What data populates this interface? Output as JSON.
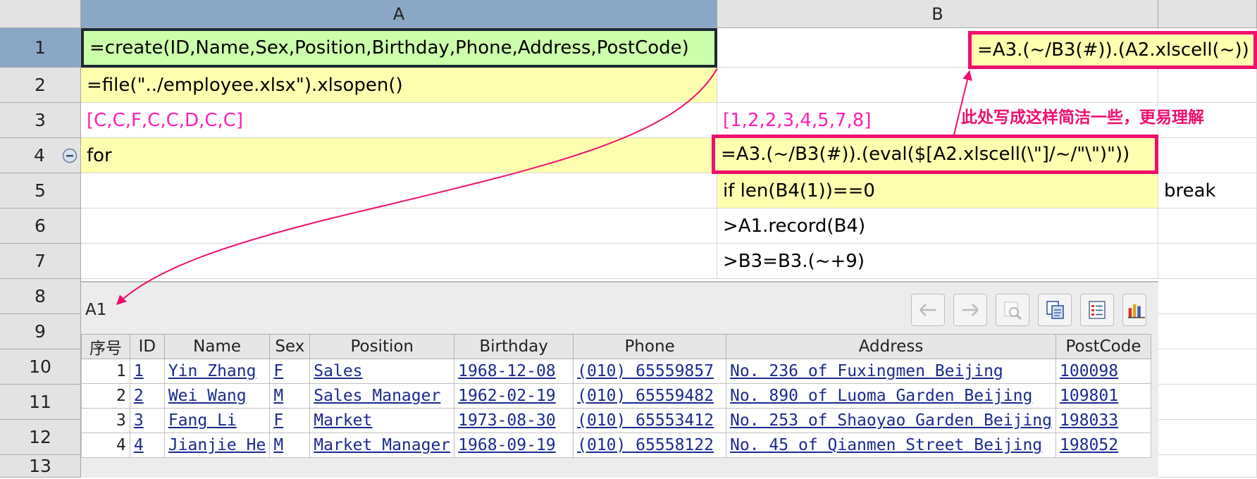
{
  "columns": {
    "corner": "",
    "a": "A",
    "b": "B",
    "c": ""
  },
  "rows": [
    "1",
    "2",
    "3",
    "4",
    "5",
    "6",
    "7",
    "8",
    "9",
    "10",
    "11",
    "12",
    "13"
  ],
  "cells": {
    "a1": "=create(ID,Name,Sex,Position,Birthday,Phone,Address,PostCode)",
    "a2": "=file(\"../employee.xlsx\").xlsopen()",
    "a3": "[C,C,F,C,C,D,C,C]",
    "a4": "for",
    "b3": "[1,2,2,3,4,5,7,8]",
    "b4": "=A3.(~/B3(#)).(eval($[A2.xlscell(\\\"]/~/\"\\\")\"))",
    "b5": "if len(B4(1))==0",
    "c5": "break",
    "b6": ">A1.record(B4)",
    "b7": ">B3=B3.(~+9)",
    "b1_callout": "=A3.(~/B3(#)).(A2.xlscell(~))"
  },
  "annotation": "此处写成这样简洁一些，更易理解",
  "collapse_icon": "minus-circle-icon",
  "result_panel": {
    "cell_ref": "A1",
    "toolbar": [
      "arrow-left-icon",
      "arrow-right-icon",
      "zoom-icon",
      "copy-icon",
      "list-icon",
      "chart-icon"
    ],
    "headers": [
      "序号",
      "ID",
      "Name",
      "Sex",
      "Position",
      "Birthday",
      "Phone",
      "Address",
      "PostCode"
    ],
    "rows": [
      [
        "1",
        "1",
        "Yin Zhang",
        "F",
        "Sales",
        "1968-12-08",
        "(010) 65559857",
        "No. 236 of Fuxingmen Beijing",
        "100098"
      ],
      [
        "2",
        "2",
        "Wei Wang",
        "M",
        "Sales Manager",
        "1962-02-19",
        "(010) 65559482",
        "No. 890 of Luoma Garden Beijing",
        "109801"
      ],
      [
        "3",
        "3",
        "Fang Li",
        "F",
        "Market",
        "1973-08-30",
        "(010) 65553412",
        "No. 253 of Shaoyao Garden Beijing",
        "198033"
      ],
      [
        "4",
        "4",
        "Jianjie He",
        "M",
        "Market Manager",
        "1968-09-19",
        "(010) 65558122",
        "No. 45 of Qianmen Street Beijing",
        "198052"
      ]
    ]
  },
  "colors": {
    "selected_header": "#8aa7c5",
    "formula_bg": "#ffffb0",
    "active_cell_bg": "#ccffaa",
    "highlight": "#ef0f6e",
    "constant_text": "#ff1fb4",
    "link": "#1b2a8f"
  }
}
